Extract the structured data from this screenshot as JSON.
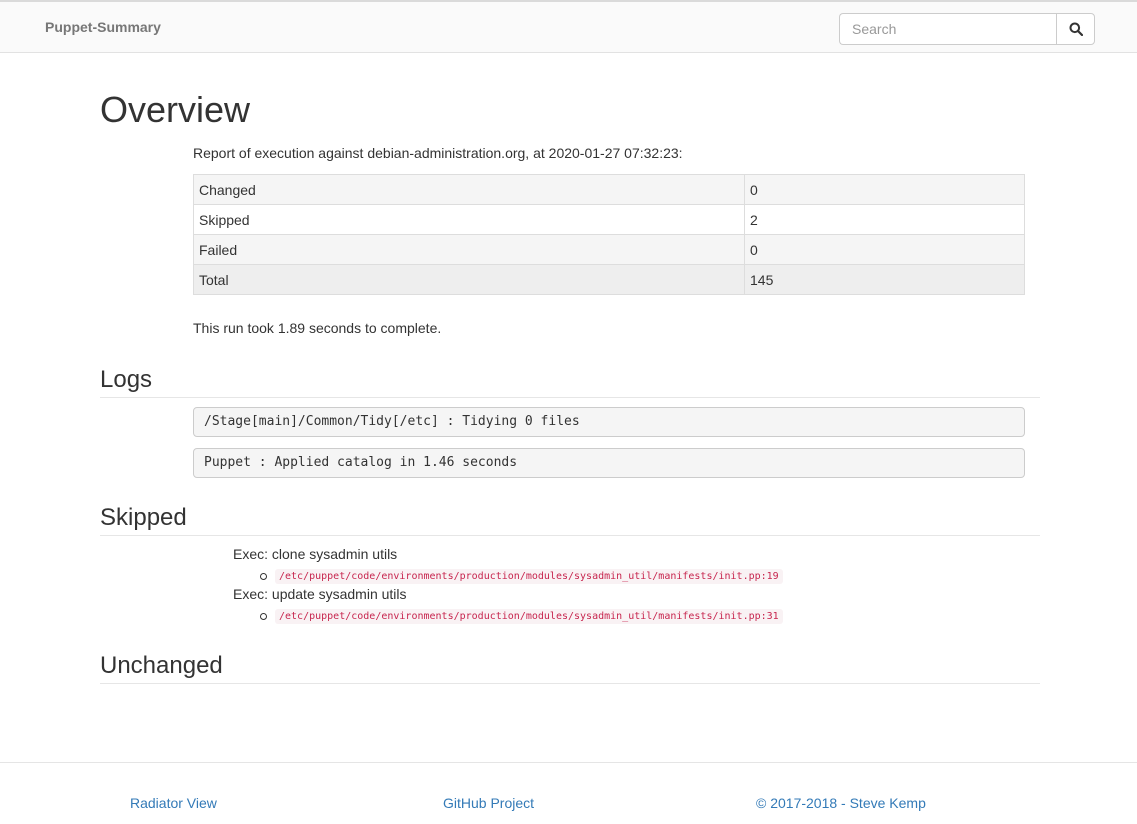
{
  "navbar": {
    "brand": "Puppet-Summary",
    "search": {
      "placeholder": "Search",
      "value": ""
    },
    "search_button_icon": "search-icon"
  },
  "overview": {
    "title": "Overview",
    "report_text": "Report of execution against debian-administration.org, at 2020-01-27 07:32:23:",
    "summary": [
      {
        "label": "Changed",
        "value": "0"
      },
      {
        "label": "Skipped",
        "value": "2"
      },
      {
        "label": "Failed",
        "value": "0"
      },
      {
        "label": "Total",
        "value": "145"
      }
    ],
    "run_text": "This run took 1.89 seconds to complete."
  },
  "logs": {
    "title": "Logs",
    "lines": [
      "/Stage[main]/Common/Tidy[/etc] : Tidying 0 files",
      "Puppet : Applied catalog in 1.46 seconds"
    ]
  },
  "skipped": {
    "title": "Skipped",
    "items": [
      {
        "name": "Exec: clone sysadmin utils",
        "path": "/etc/puppet/code/environments/production/modules/sysadmin_util/manifests/init.pp:19"
      },
      {
        "name": "Exec: update sysadmin utils",
        "path": "/etc/puppet/code/environments/production/modules/sysadmin_util/manifests/init.pp:31"
      }
    ]
  },
  "unchanged": {
    "title": "Unchanged"
  },
  "footer": {
    "radiator": "Radiator View",
    "github": "GitHub Project",
    "copyright": "© 2017-2018 - Steve Kemp"
  },
  "colors": {
    "link": "#337ab7",
    "code": "#c7254e",
    "code_bg": "#f9f2f4"
  }
}
